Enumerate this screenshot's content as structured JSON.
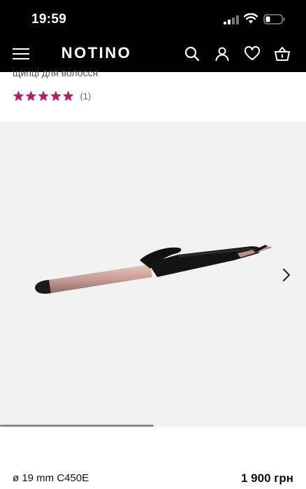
{
  "status_bar": {
    "time": "19:59",
    "icons": [
      "signal-icon",
      "wifi-icon",
      "battery-icon"
    ]
  },
  "header": {
    "logo": "NOTINO",
    "icons": [
      "menu-icon",
      "search-icon",
      "account-icon",
      "heart-icon",
      "basket-icon"
    ]
  },
  "product": {
    "subtitle": "щипці для волосся",
    "rating": {
      "stars": 5,
      "count": "(1)"
    },
    "gallery": {
      "image": "curling-iron-image",
      "progress": 0.5
    },
    "variant": "ø 19 mm C450E",
    "price": "1 900 грн"
  },
  "colors": {
    "header_bg": "#000000",
    "star": "#b71d61",
    "gallery_bg": "#f2f2f2"
  }
}
